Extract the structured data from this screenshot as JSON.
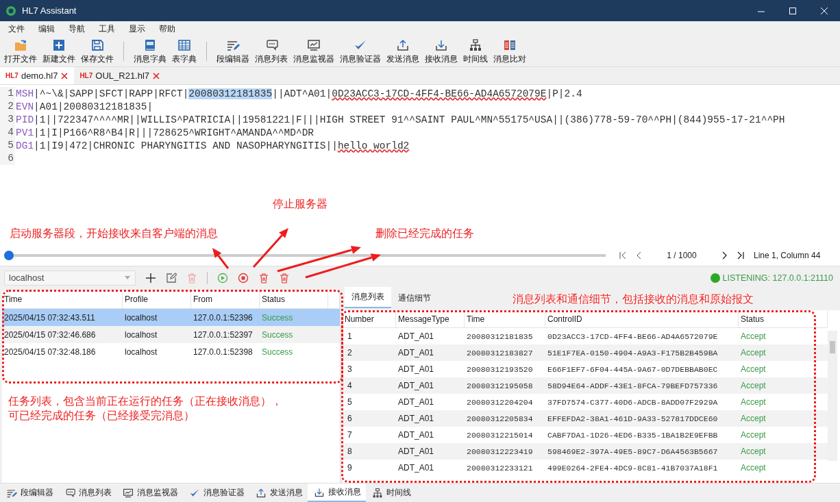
{
  "window": {
    "title": "HL7 Assistant"
  },
  "menu": [
    "文件",
    "编辑",
    "导航",
    "工具",
    "显示",
    "帮助"
  ],
  "toolbar": [
    [
      "打开文件",
      "新建文件",
      "保存文件"
    ],
    [
      "消息字典",
      "表字典"
    ],
    [
      "段编辑器",
      "消息列表",
      "消息监视器",
      "消息验证器",
      "发送消息",
      "接收消息",
      "时间线",
      "消息比对"
    ]
  ],
  "file_tabs": [
    {
      "badge": "HL7",
      "label": "demo.hl7",
      "selected": true
    },
    {
      "badge": "HL7",
      "label": "OUL_R21.hl7",
      "selected": false
    }
  ],
  "editor": {
    "lines": [
      {
        "number": "1",
        "parts": [
          {
            "kind": "segment",
            "text": "MSH"
          },
          {
            "kind": "plain",
            "text": "|^~\\&|SAPP|SFCT|RAPP|RFCT|"
          },
          {
            "kind": "selected",
            "text": "20080312181835"
          },
          {
            "kind": "plain",
            "text": "||ADT^A01|"
          },
          {
            "kind": "misspelled",
            "text": "0D23ACC3-17CD-4FF4-BE66-AD4A6572079E"
          },
          {
            "kind": "plain",
            "text": "|P|2.4"
          }
        ]
      },
      {
        "number": "2",
        "parts": [
          {
            "kind": "segment",
            "text": "EVN"
          },
          {
            "kind": "plain",
            "text": "|A01|20080312181835|"
          }
        ]
      },
      {
        "number": "3",
        "parts": [
          {
            "kind": "segment",
            "text": "PID"
          },
          {
            "kind": "plain",
            "text": "|1||722347^^^^MR||WILLIS^PATRICIA||19581221|F|||HIGH STREET 91^^SAINT PAUL^MN^55175^USA||(386)778-59-70^^PH|(844)955-17-21^^PH"
          }
        ]
      },
      {
        "number": "4",
        "parts": [
          {
            "kind": "segment",
            "text": "PV1"
          },
          {
            "kind": "plain",
            "text": "|1|I|P166^R8^B4|R|||728625^WRIGHT^AMANDA^^MD^DR"
          }
        ]
      },
      {
        "number": "5",
        "parts": [
          {
            "kind": "segment",
            "text": "DG1"
          },
          {
            "kind": "plain",
            "text": "|1|I9|472|CHRONIC PHARYNGITIS AND NASOPHARYNGITIS||"
          },
          {
            "kind": "misspelled",
            "text": "hello world2"
          }
        ]
      },
      {
        "number": "6"
      }
    ]
  },
  "navigator": {
    "level": 0,
    "page": "1 / 1000",
    "position": "Line 1, Column 44"
  },
  "server_bar": {
    "profile": "localhost",
    "status": "LISTENING: 127.0.0.1:21110"
  },
  "tasks": {
    "columns": [
      "Time",
      "Profile",
      "From",
      "Status"
    ],
    "rows": [
      {
        "cells": [
          "2025/04/15 07:32:43.511",
          "localhost",
          "127.0.0.1:52396",
          "Success"
        ],
        "selected": true
      },
      {
        "cells": [
          "2025/04/15 07:32:46.686",
          "localhost",
          "127.0.0.1:52397",
          "Success"
        ],
        "selected": false
      },
      {
        "cells": [
          "2025/04/15 07:32:48.186",
          "localhost",
          "127.0.0.1:52398",
          "Success"
        ],
        "selected": false
      }
    ]
  },
  "message_tabs": [
    {
      "label": "消息列表",
      "selected": true
    },
    {
      "label": "通信细节",
      "selected": false
    }
  ],
  "messages": {
    "columns": [
      "Number",
      "MessageType",
      "Time",
      "ControlID",
      "Status"
    ],
    "rows": [
      [
        "1",
        "ADT_A01",
        "20080312181835",
        "0D23ACC3-17CD-4FF4-BE66-AD4A6572079E",
        "Accept"
      ],
      [
        "2",
        "ADT_A01",
        "20080312183827",
        "51E1F7EA-0150-4904-A9A3-F175B2B459BA",
        "Accept"
      ],
      [
        "3",
        "ADT_A01",
        "20080312193520",
        "E66F1EF7-6F04-445A-9A67-0D7DEBBAB0EC",
        "Accept"
      ],
      [
        "4",
        "ADT_A01",
        "20080312195058",
        "58D94E64-ADDF-43E1-8FCA-79BEFD757336",
        "Accept"
      ],
      [
        "5",
        "ADT_A01",
        "20080312204204",
        "37FD7574-C377-40D6-ADCB-8ADD07F2929A",
        "Accept"
      ],
      [
        "6",
        "ADT_A01",
        "20080312205834",
        "EFFEFDA2-38A1-461D-9A33-527817DDCE60",
        "Accept"
      ],
      [
        "7",
        "ADT_A01",
        "20080312215014",
        "CABF7DA1-1D26-4ED6-B335-1BA1B2E9EFBB",
        "Accept"
      ],
      [
        "8",
        "ADT_A01",
        "20080312223419",
        "598469E2-397A-49E5-89C7-D6A4563B5667",
        "Accept"
      ],
      [
        "9",
        "ADT_A01",
        "20080312233121",
        "499E0264-2FE4-4DC9-8C81-41B7037A18F1",
        "Accept"
      ]
    ]
  },
  "bottom_tabs": [
    {
      "label": "段编辑器",
      "selected": false
    },
    {
      "label": "消息列表",
      "selected": false
    },
    {
      "label": "消息监视器",
      "selected": false
    },
    {
      "label": "消息验证器",
      "selected": false
    },
    {
      "label": "发送消息",
      "selected": false
    },
    {
      "label": "接收消息",
      "selected": true
    },
    {
      "label": "时间线",
      "selected": false
    }
  ],
  "annotations": [
    "启动服务器段，开始接收来自客户端的消息",
    "停止服务器",
    "删除已经完成的任务",
    "消息列表和通信细节，包括接收的消息和原始报文",
    "任务列表，包含当前正在运行的任务（正在接收消息），",
    "可已经完成的任务（已经接受完消息）"
  ]
}
